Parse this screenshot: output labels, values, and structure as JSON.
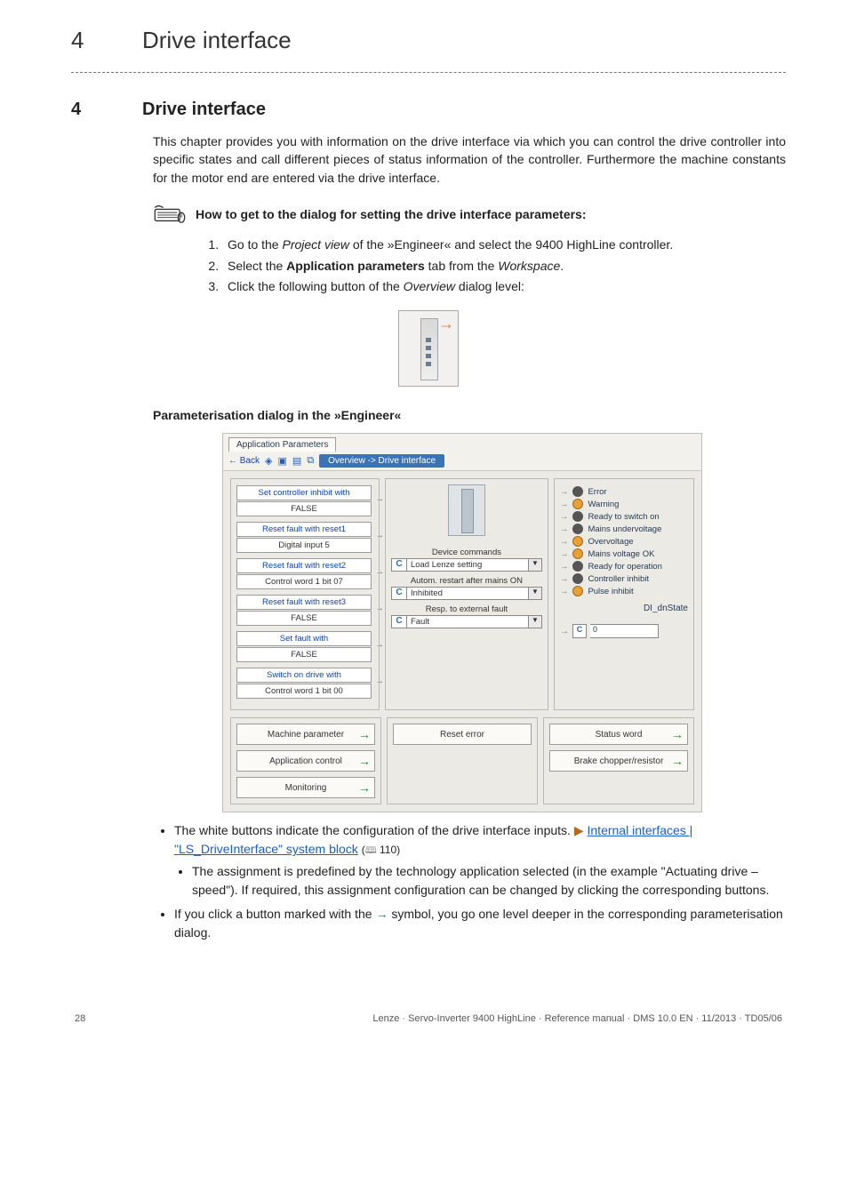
{
  "running_head": {
    "num": "4",
    "title": "Drive interface"
  },
  "chapter": {
    "num": "4",
    "title": "Drive interface"
  },
  "intro": "This chapter provides you with information on the drive interface via which you can control the drive controller into specific states and call different pieces of status information of the controller. Furthermore the machine constants for the motor end are entered via the drive interface.",
  "howto_caption": "How to get to the dialog for setting the drive interface parameters:",
  "steps": {
    "s1_a": "Go to the ",
    "s1_em": "Project view",
    "s1_b": " of the »Engineer« and select the 9400 HighLine controller.",
    "s2_a": "Select the ",
    "s2_strong": "Application parameters",
    "s2_b": " tab from the ",
    "s2_em": "Workspace",
    "s2_c": ".",
    "s3_a": "Click the following button of the ",
    "s3_em": "Overview",
    "s3_b": " dialog level:"
  },
  "subhead": "Parameterisation dialog in the »Engineer«",
  "shot": {
    "tab": "Application Parameters",
    "back": "Back",
    "crumb": "Overview -> Drive interface",
    "left": [
      {
        "top": "Set controller inhibit with",
        "bot": "FALSE"
      },
      {
        "top": "Reset fault with reset1",
        "bot": "Digital input 5"
      },
      {
        "top": "Reset fault with reset2",
        "bot": "Control word 1 bit 07"
      },
      {
        "top": "Reset fault with reset3",
        "bot": "FALSE"
      },
      {
        "top": "Set fault with",
        "bot": "FALSE"
      },
      {
        "top": "Switch on drive with",
        "bot": "Control word 1 bit 00"
      }
    ],
    "mid": {
      "l1": "Device commands",
      "v1": "Load Lenze setting",
      "l2": "Autom. restart after mains ON",
      "v2": "Inhibited",
      "l3": "Resp. to external fault",
      "v3": "Fault"
    },
    "leds": [
      "Error",
      "Warning",
      "Ready to switch on",
      "Mains undervoltage",
      "Overvoltage",
      "Mains voltage OK",
      "Ready for operation",
      "Controller inhibit",
      "Pulse inhibit"
    ],
    "dn_label": "DI_dnState",
    "dn_val": "0",
    "bl": [
      "Machine parameter",
      "Application control",
      "Monitoring"
    ],
    "bm": [
      "Reset error"
    ],
    "br": [
      "Status word",
      "Brake chopper/resistor"
    ]
  },
  "b1_a": "The white buttons indicate the configuration of the drive interface inputs.  ",
  "b1_link": "Internal interfaces | \"LS_DriveInterface\" system block",
  "b1_pg": " 110)",
  "b1_sub": "The assignment is predefined by the technology application selected (in the example \"Actuating drive – speed\"). If required, this assignment configuration can be changed by clicking the corresponding buttons.",
  "b2_a": "If you click a button marked with the ",
  "b2_b": " symbol, you go one level deeper in the corresponding parameterisation dialog.",
  "footer": {
    "page": "28",
    "meta": "Lenze · Servo-Inverter 9400 HighLine · Reference manual · DMS 10.0 EN · 11/2013 · TD05/06"
  }
}
